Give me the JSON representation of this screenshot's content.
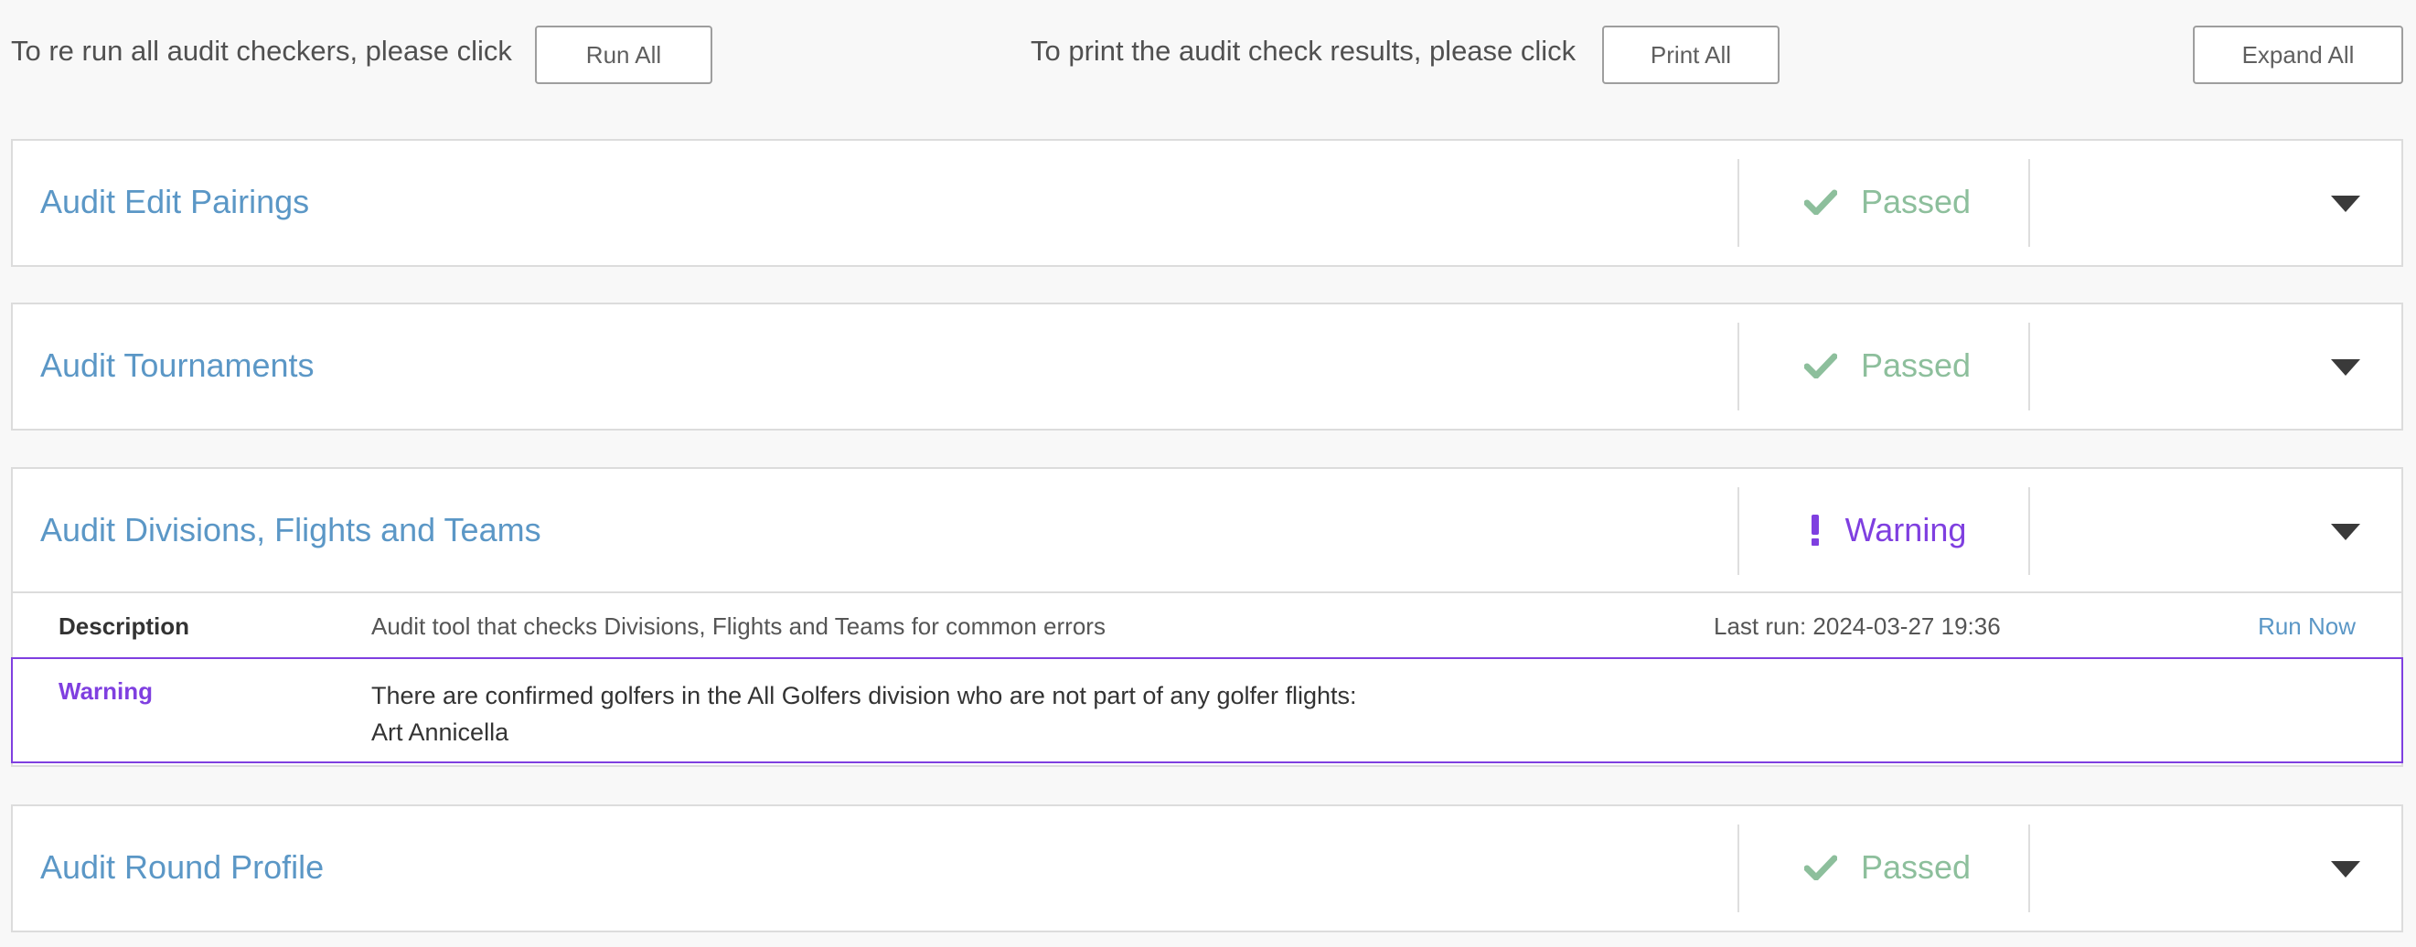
{
  "toolbar": {
    "rerun_text": "To re run all audit checkers, please click",
    "run_all_label": "Run All",
    "print_text": "To print the audit check results, please click",
    "print_all_label": "Print All",
    "expand_all_label": "Expand All"
  },
  "colors": {
    "title_blue": "#5b97c6",
    "passed_green": "#8dbf9c",
    "warning_purple": "#7f3fe0"
  },
  "audits": [
    {
      "title": "Audit Edit Pairings",
      "status": "Passed",
      "status_icon": "check-icon"
    },
    {
      "title": "Audit Tournaments",
      "status": "Passed",
      "status_icon": "check-icon"
    },
    {
      "title": "Audit Divisions, Flights and Teams",
      "status": "Warning",
      "status_icon": "exclamation-icon",
      "description_label": "Description",
      "description": "Audit tool that checks Divisions, Flights and Teams for common errors",
      "last_run": "Last run: 2024-03-27 19:36",
      "run_now_label": "Run Now",
      "warning_label": "Warning",
      "warning_message": "There are confirmed golfers in the All Golfers division who are not part of any golfer flights:",
      "warning_golfer": "Art Annicella"
    },
    {
      "title": "Audit Round Profile",
      "status": "Passed",
      "status_icon": "check-icon"
    }
  ]
}
